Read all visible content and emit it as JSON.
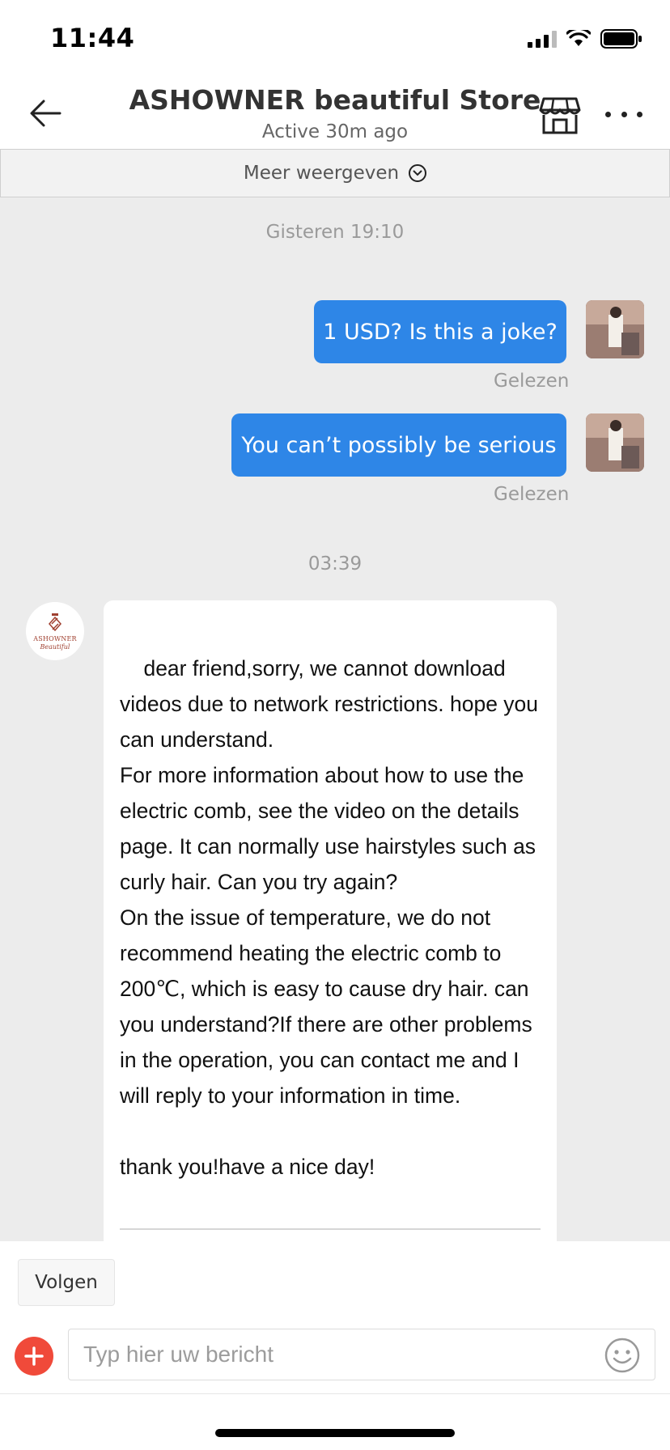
{
  "status_bar": {
    "time": "11:44"
  },
  "header": {
    "title": "ASHOWNER beautiful Store",
    "subtitle": "Active 30m ago",
    "icons": {
      "back": "back-arrow-icon",
      "store": "store-icon",
      "more": "more-dots-icon"
    }
  },
  "more_bar": {
    "label": "Meer weergeven"
  },
  "chat": {
    "timestamps": [
      "Gisteren 19:10",
      "03:39"
    ],
    "outgoing": [
      {
        "text": "1 USD? Is this a joke?",
        "status": "Gelezen"
      },
      {
        "text": "You can’t possibly be serious",
        "status": "Gelezen"
      }
    ],
    "store_avatar": {
      "logo_text": "ASHOWNER",
      "logo_sub": "Beautiful"
    },
    "incoming": {
      "text": "dear friend,sorry, we cannot download videos due to network restrictions. hope you can understand.\nFor more information about how to use the electric comb, see the video on the details page. It can normally use hairstyles such as curly hair. Can you try again?\nOn the issue of temperature, we do not recommend heating the electric comb to 200℃, which is easy to cause dry hair. can you understand?If there are other problems in the operation, you can contact me and I will reply to your information in time.\n\nthank you!have a nice day!"
    }
  },
  "bottom": {
    "follow_label": "Volgen",
    "input_placeholder": "Typ hier uw bericht",
    "icons": {
      "plus": "plus-icon",
      "emoji": "emoji-icon"
    }
  },
  "colors": {
    "accent": "#2e86e7",
    "plus": "#f04a3a",
    "chat_bg": "#ececec"
  }
}
